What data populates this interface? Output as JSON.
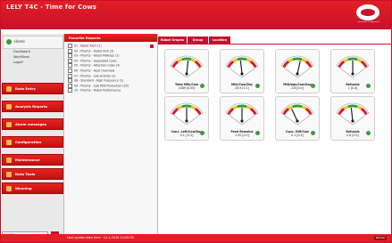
{
  "app": {
    "title": "LELY T4C - Time for Cows",
    "logo_tagline": "innovators in agriculture"
  },
  "nav": {
    "home_label": "Home",
    "home_links": [
      "Dashboard",
      "Workflows",
      "Logoff"
    ],
    "buttons": [
      {
        "label": "Data Entry",
        "icon": "pencil-icon"
      },
      {
        "label": "Analysis Reports",
        "icon": "chart-icon"
      },
      {
        "label": "Alarm messages",
        "icon": "bell-icon"
      },
      {
        "label": "Configuration",
        "icon": "wrench-icon"
      },
      {
        "label": "Maintenance",
        "icon": "tools-icon"
      },
      {
        "label": "Data Tools",
        "icon": "database-icon"
      },
      {
        "label": "Weaning",
        "icon": "calf-icon"
      }
    ],
    "search_placeholder": "Cow list",
    "go_label": "▶"
  },
  "tree": {
    "header": "Favorite Reports",
    "items": [
      "01 - Robot Alert (1)",
      "02 - Priority - Robot Visit (3)",
      "03 - Priority - Failed Milkings (1)",
      "04 - Priority - Separated Cows",
      "05 - Priority - Attention Cows (4)",
      "06 - Priority - Heat Overview",
      "07 - Priority - Low Activity (2)",
      "08 - Standard - High Frequency (1)",
      "09 - Priority - Low Milk Production (25)",
      "10 - Priority - Robot Performance"
    ]
  },
  "tabs": [
    "Robot Graphs",
    "Group",
    "Location"
  ],
  "gauges": [
    {
      "label": "Total Milk/Cow",
      "value": "1089 [0.05]",
      "level": 0.55,
      "status_color": "#3a9d3a"
    },
    {
      "label": "Milk/Cow/Day",
      "value": "29.9 [0.1]",
      "level": 0.45,
      "status_color": "#3a9d3a"
    },
    {
      "label": "Milkings/Cow/Day",
      "value": "2.8 [0.0]",
      "level": 0.6,
      "status_color": "#3a9d3a"
    },
    {
      "label": "Refusals",
      "value": "1 [0.0]",
      "level": 0.5,
      "status_color": "#3a9d3a"
    },
    {
      "label": "Conc. Left/Cow/Day",
      "value": "0.1 [-0.2]",
      "level": 0.5,
      "status_color": "#3a9d3a"
    },
    {
      "label": "Feed Remains",
      "value": "1.50 [0.0]",
      "level": 0.5,
      "status_color": "#3a9d3a"
    },
    {
      "label": "Conc. Diff/Cow",
      "value": "0.1 [0.5]",
      "level": 0.3,
      "status_color": "#3a9d3a"
    },
    {
      "label": "Refusals",
      "value": "0.8 [0.0]",
      "level": 0.45,
      "status_color": "#3a9d3a"
    }
  ],
  "status": {
    "text": "Last update data time : 12-1-2010 14:00:25",
    "button": "Refresh"
  },
  "colors": {
    "brand_red": "#c8102e",
    "ok_green": "#3a9d3a"
  }
}
